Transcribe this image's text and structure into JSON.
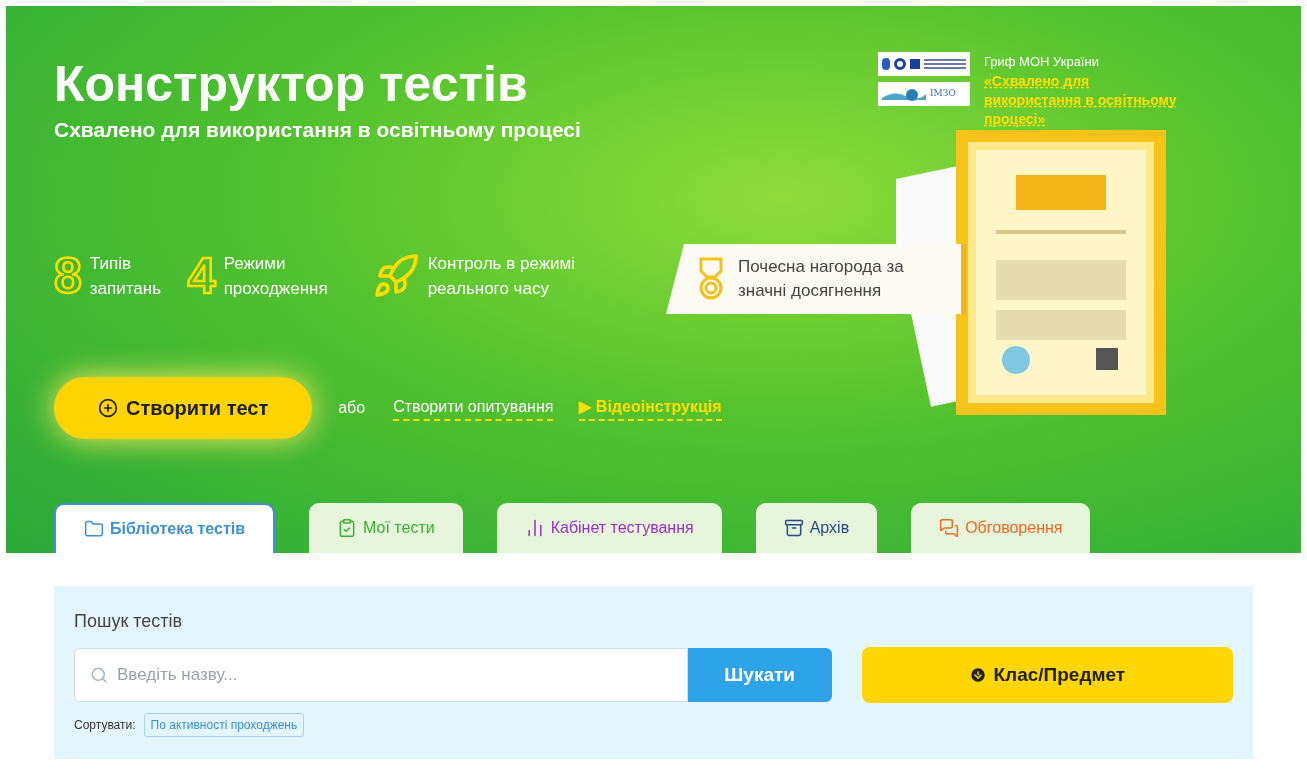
{
  "hero": {
    "title": "Конструктор тестів",
    "subtitle": "Схвалено для використання в освітньому процесі",
    "approval": {
      "logo_text": "ІМЗО",
      "label": "Гриф МОН України",
      "link": "«Схвалено для використання в освітньому процесі»"
    },
    "features": [
      {
        "kind": "numeral",
        "numeral": "8",
        "text": "Типів запитань"
      },
      {
        "kind": "numeral",
        "numeral": "4",
        "text": "Режими проходження"
      },
      {
        "kind": "rocket",
        "text": "Контроль в режимі реального часу"
      }
    ],
    "award": "Почесна нагорода за значні досягнення",
    "create_button": "Створити тест",
    "or": "або",
    "survey_link": "Створити опитування",
    "video_link": "Відеоінструкція",
    "video_marker": "▶"
  },
  "tabs": [
    {
      "label": "Бібліотека тестів",
      "kind": "folder",
      "color": "#3f8fd8",
      "selected": true
    },
    {
      "label": "Мої тести",
      "kind": "clipboard",
      "color": "#36b52a",
      "selected": false
    },
    {
      "label": "Кабінет тестування",
      "kind": "bars",
      "color": "#9b2fc9",
      "selected": false
    },
    {
      "label": "Архів",
      "kind": "archive",
      "color": "#264b86",
      "selected": false
    },
    {
      "label": "Обговорення",
      "kind": "chat",
      "color": "#f06a1e",
      "selected": false
    }
  ],
  "search": {
    "title": "Пошук тестів",
    "placeholder": "Введіть назву...",
    "button": "Шукати",
    "filter_button": "Клас/Предмет",
    "sort_label": "Сортувати:",
    "sort_value": "По активності проходжень"
  }
}
